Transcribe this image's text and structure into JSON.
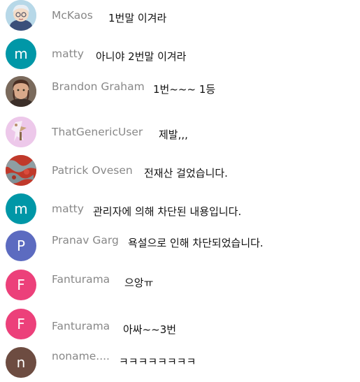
{
  "messages": [
    {
      "author": "McKaos",
      "text": "1번말 이겨라",
      "avatar": {
        "type": "image",
        "icon": "anime-character-avatar",
        "color": "#b7d8e8"
      }
    },
    {
      "author": "matty",
      "text": "아니야 2번말 이겨라",
      "avatar": {
        "type": "letter",
        "letter": "m",
        "color": "#0097a7"
      }
    },
    {
      "author": "Brandon Graham",
      "text": "1번~~~ 1등",
      "avatar": {
        "type": "image",
        "icon": "man-photo-avatar",
        "color": "#6b4a3a"
      }
    },
    {
      "author": "ThatGenericUser",
      "text": "제발,,,",
      "avatar": {
        "type": "image",
        "icon": "pink-illustration-avatar",
        "color": "#e9c3e6"
      }
    },
    {
      "author": "Patrick Ovesen",
      "text": "전재산 걸었습니다.",
      "avatar": {
        "type": "image",
        "icon": "red-pattern-avatar",
        "color": "#c0392b"
      }
    },
    {
      "author": "matty",
      "text": "관리자에 의해 차단된 내용입니다.",
      "avatar": {
        "type": "letter",
        "letter": "m",
        "color": "#0097a7"
      }
    },
    {
      "author": "Pranav Garg",
      "text": "욕설으로 인해 차단되었습니다.",
      "avatar": {
        "type": "letter",
        "letter": "P",
        "color": "#5c6bc0"
      }
    },
    {
      "author": "Fanturama",
      "text": "으앙ㅠ",
      "avatar": {
        "type": "letter",
        "letter": "F",
        "color": "#ec407a"
      }
    },
    {
      "author": "Fanturama",
      "text": "아싸~~3번",
      "avatar": {
        "type": "letter",
        "letter": "F",
        "color": "#ec407a"
      }
    },
    {
      "author": "noname....",
      "text": "ㅋㅋㅋㅋㅋㅋㅋㅋ",
      "avatar": {
        "type": "letter",
        "letter": "n",
        "color": "#6d4c41"
      }
    }
  ]
}
